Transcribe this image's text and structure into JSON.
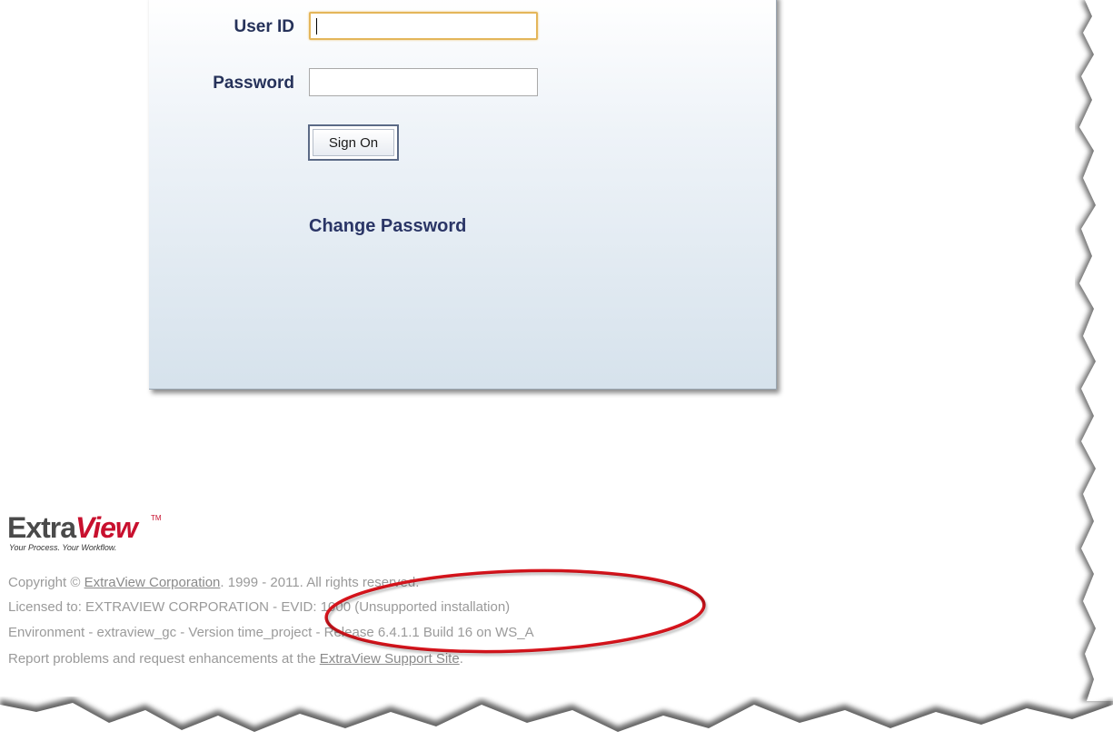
{
  "login": {
    "user_id_label": "User ID",
    "password_label": "Password",
    "user_id_value": "",
    "password_value": "",
    "sign_on_label": "Sign On",
    "change_password_label": "Change Password"
  },
  "logo": {
    "text_extra": "Extra",
    "text_view": "View",
    "trademark": "TM",
    "tagline": "Your Process. Your Workflow."
  },
  "footer": {
    "line1_prefix": "Copyright © ",
    "line1_link": "ExtraView Corporation",
    "line1_suffix": ". 1999 - 2011.  All rights reserved.",
    "line2": "Licensed to: EXTRAVIEW CORPORATION - EVID: 1000 (Unsupported installation)",
    "line3": "Environment - extraview_gc - Version time_project - Release 6.4.1.1 Build 16 on WS_A",
    "line4_prefix": "Report problems and request enhancements at the ",
    "line4_link": "ExtraView Support Site",
    "line4_suffix": "."
  },
  "colors": {
    "label_navy": "#26325a",
    "annotation_red": "#d8141c",
    "logo_red": "#c8102e",
    "focus_outline": "#e4b65a"
  }
}
